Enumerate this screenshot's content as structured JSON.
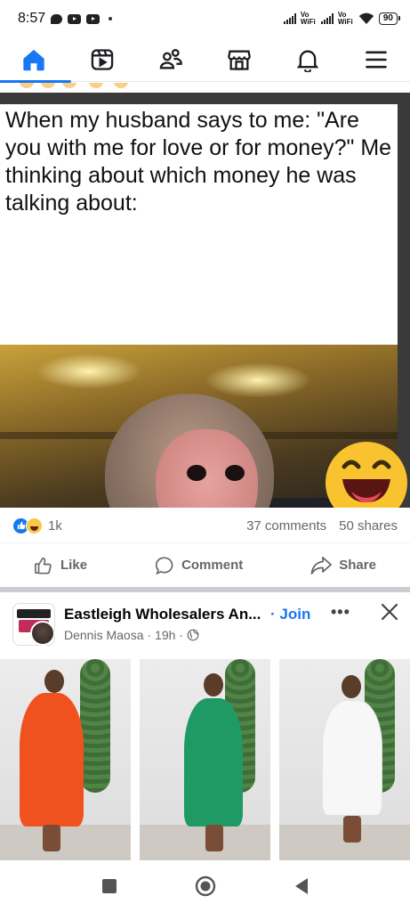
{
  "status_bar": {
    "time": "8:57",
    "network_1": "Vo WiFi",
    "network_2": "Vo WiFi",
    "battery": "90"
  },
  "nav": {
    "tabs": [
      {
        "name": "home-icon",
        "active": true
      },
      {
        "name": "video-icon",
        "active": false
      },
      {
        "name": "friends-icon",
        "active": false
      },
      {
        "name": "marketplace-icon",
        "active": false
      },
      {
        "name": "bell-icon",
        "active": false
      },
      {
        "name": "menu-icon",
        "active": false
      }
    ],
    "accent": "#1877f2"
  },
  "meme": {
    "caption": "When my husband says to me: \"Are you with me for love or for money?\" Me thinking about which money he was talking about:"
  },
  "post": {
    "reaction_count": "1k",
    "comments": "37 comments",
    "shares": "50 shares",
    "actions": {
      "like": "Like",
      "comment": "Comment",
      "share": "Share"
    }
  },
  "group_post": {
    "group_name": "Eastleigh Wholesalers An...",
    "join": "· Join",
    "author": "Dennis Maosa",
    "time": "· 19h ·",
    "more": "•••"
  },
  "colors": {
    "accent": "#1877f2",
    "secondary_text": "#65676b"
  }
}
